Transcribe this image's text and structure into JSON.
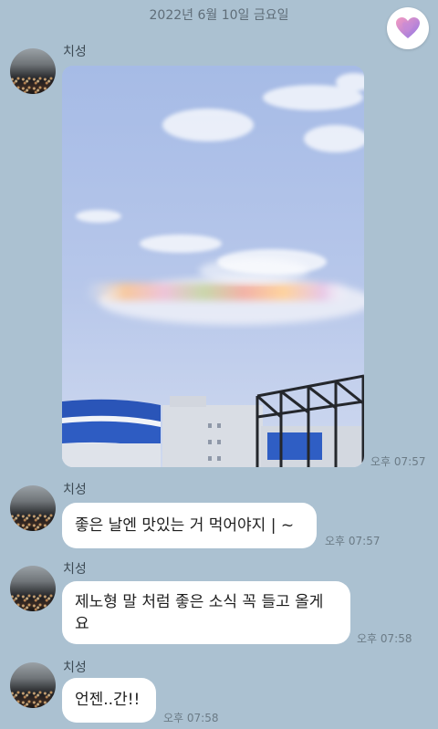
{
  "date_separator": "2022년 6월 10일 금요일",
  "sender_name": "치성",
  "messages": [
    {
      "type": "photo",
      "time": "오후 07:57"
    },
    {
      "type": "text",
      "text": "좋은 날엔 맛있는 거 먹어야지 | ~",
      "time": "오후 07:57"
    },
    {
      "type": "text",
      "text": "제노형 말 처럼 좋은 소식 꼭 들고 올게요",
      "line1": "제노형 말 처럼 좋은 소식 꼭 들고 올게",
      "line2": "요",
      "time": "오후 07:58"
    },
    {
      "type": "text",
      "text": "언젠..간!!",
      "time": "오후 07:58"
    }
  ],
  "colors": {
    "background": "#abc1d1",
    "bubble": "#ffffff",
    "heart_gradient": [
      "#f08fb8",
      "#9b7be8"
    ]
  },
  "icons": [
    "heart-icon"
  ]
}
